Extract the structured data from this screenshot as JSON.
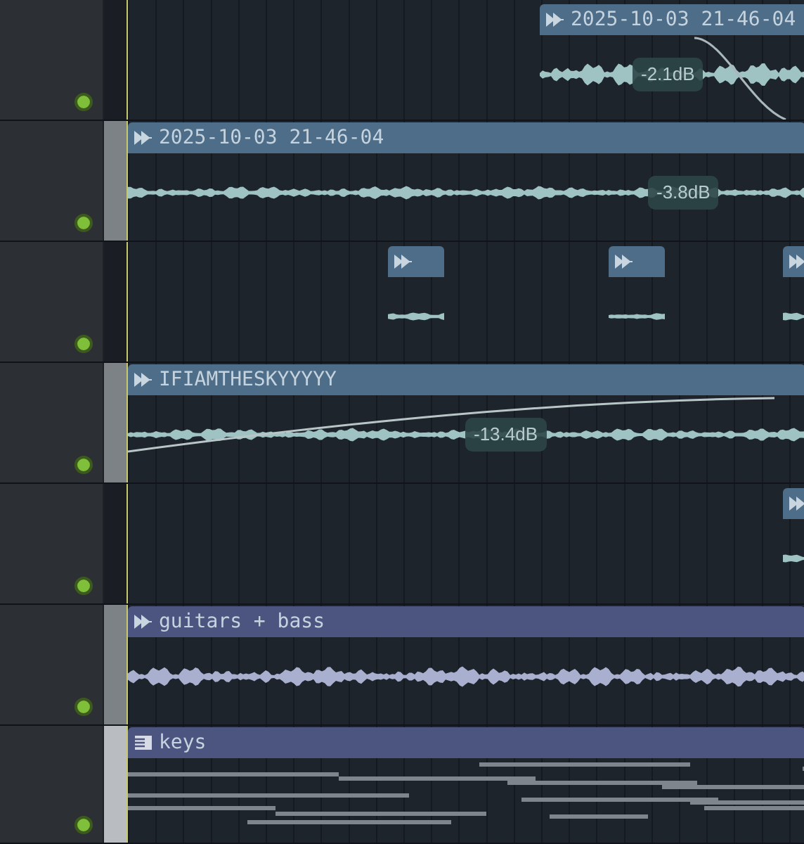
{
  "tracks": [
    {
      "on": true,
      "clips": [
        {
          "kind": "audio",
          "title": "2025-10-03 21-46-04",
          "color": "#4e6d88",
          "volume": "-2.1dB"
        }
      ]
    },
    {
      "on": true,
      "color": "#7d8287",
      "clips": [
        {
          "kind": "audio",
          "title": "2025-10-03 21-46-04",
          "color": "#4e6d88",
          "volume": "-3.8dB"
        }
      ]
    },
    {
      "on": true,
      "clips": [
        {
          "kind": "audio",
          "color": "#4e6d88"
        },
        {
          "kind": "audio",
          "color": "#4e6d88"
        },
        {
          "kind": "audio",
          "color": "#4e6d88"
        }
      ]
    },
    {
      "on": true,
      "color": "#7d8287",
      "clips": [
        {
          "kind": "audio",
          "title": "IFIAMTHESKYYYYY",
          "color": "#4e6d88",
          "volume": "-13.4dB"
        }
      ]
    },
    {
      "on": true,
      "clips": [
        {
          "kind": "audio",
          "color": "#4e6d88"
        }
      ]
    },
    {
      "on": true,
      "color": "#7d8287",
      "clips": [
        {
          "kind": "audio",
          "title": "guitars + bass",
          "color": "#4b5580"
        }
      ]
    },
    {
      "on": true,
      "color": "#b9bdc1",
      "clips": [
        {
          "kind": "pattern",
          "title": "keys",
          "color": "#4b5580"
        }
      ]
    }
  ]
}
